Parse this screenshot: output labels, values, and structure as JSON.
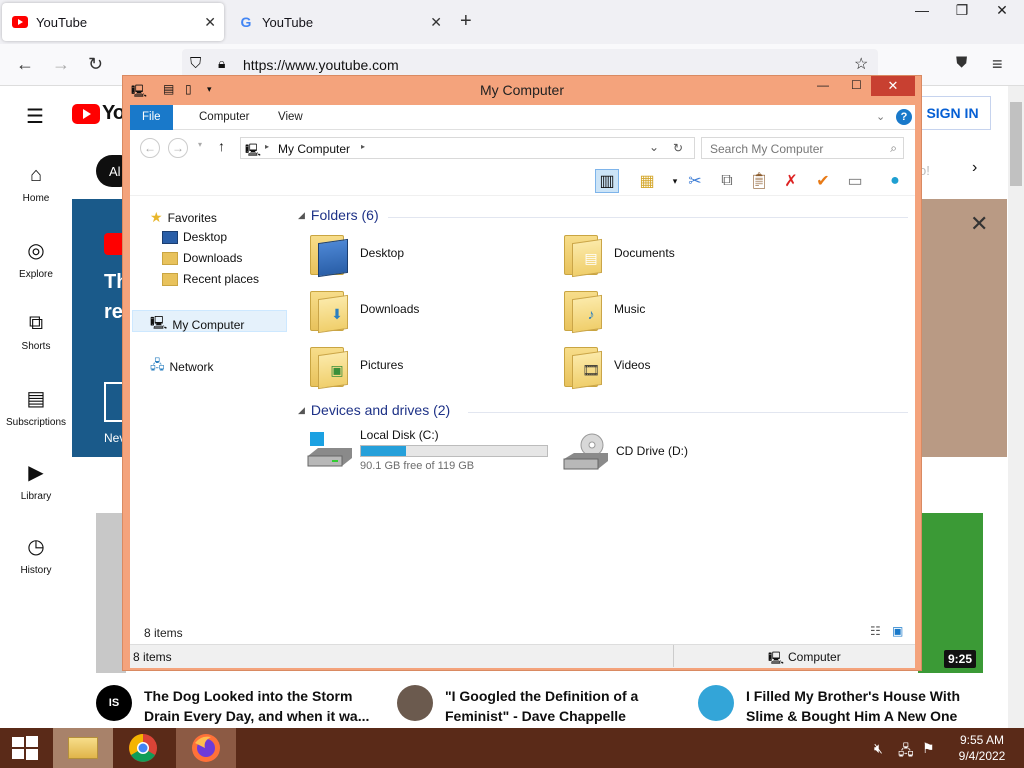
{
  "browser": {
    "tabs": [
      {
        "label": "YouTube",
        "active": true
      },
      {
        "label": "YouTube",
        "active": false
      }
    ],
    "url": "https://www.youtube.com",
    "window_controls": {
      "minimize": "—",
      "restore": "❐",
      "close": "✕"
    }
  },
  "youtube": {
    "logo_text": "Yo",
    "sign_in": "SIGN IN",
    "sidebar": [
      {
        "label": "Home",
        "icon": "home-icon"
      },
      {
        "label": "Explore",
        "icon": "compass-icon"
      },
      {
        "label": "Shorts",
        "icon": "shorts-icon"
      },
      {
        "label": "Subscriptions",
        "icon": "subscriptions-icon"
      },
      {
        "label": "Library",
        "icon": "library-icon"
      },
      {
        "label": "History",
        "icon": "history-icon"
      }
    ],
    "chip_partial": "Al",
    "chip_right_partial": "o!",
    "banner_partial": {
      "line1": "Th",
      "line2": "re",
      "foot": "Nev"
    },
    "duration": "9:25",
    "videos": [
      {
        "avatar_text": "IS",
        "title_line1": "The Dog Looked into the Storm",
        "title_line2": "Drain Every Day, and when it wa..."
      },
      {
        "avatar_text": "",
        "title_line1": "\"I Googled the Definition of a",
        "title_line2": "Feminist\" - Dave Chappelle"
      },
      {
        "avatar_text": "",
        "title_line1": "I Filled My Brother's House With",
        "title_line2": "Slime & Bought Him A New One"
      }
    ]
  },
  "explorer": {
    "title": "My Computer",
    "ribbon_tabs": [
      "File",
      "Computer",
      "View"
    ],
    "address": "My Computer",
    "search_placeholder": "Search My Computer",
    "nav": {
      "favorites": "Favorites",
      "favorites_items": [
        "Desktop",
        "Downloads",
        "Recent places"
      ],
      "my_computer": "My Computer",
      "network": "Network"
    },
    "folders_header": "Folders (6)",
    "folders": [
      "Desktop",
      "Documents",
      "Downloads",
      "Music",
      "Pictures",
      "Videos"
    ],
    "drives_header": "Devices and drives (2)",
    "drives": [
      {
        "name": "Local Disk (C:)",
        "free_text": "90.1 GB free of 119 GB",
        "used_fraction": 0.243
      },
      {
        "name": "CD Drive (D:)"
      }
    ],
    "items_count": "8 items",
    "status_items": "8 items",
    "status_location": "Computer"
  },
  "taskbar": {
    "time": "9:55 AM",
    "date": "9/4/2022"
  },
  "colors": {
    "explorer_frame": "#f4a37c",
    "explorer_close": "#c84031",
    "file_tab": "#1979ca",
    "taskbar": "#5a2a18",
    "progress_fill": "#26a0da",
    "youtube_red": "#ff0000",
    "youtube_blue": "#065fd4"
  }
}
